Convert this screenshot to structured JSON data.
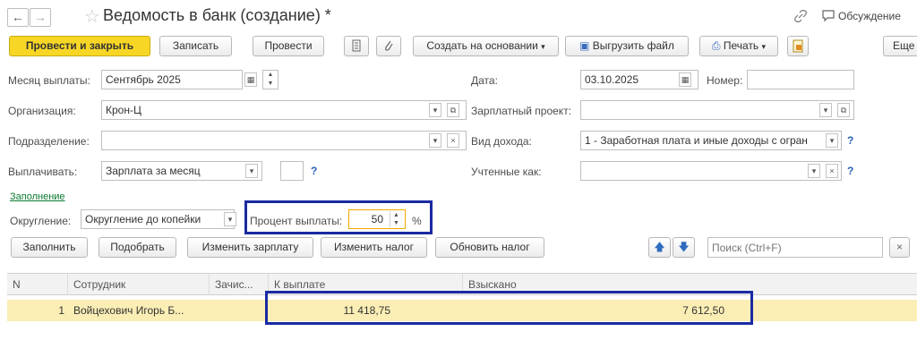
{
  "header": {
    "title": "Ведомость в банк (создание) *",
    "discussion": "Обсуждение"
  },
  "toolbar": {
    "post_close": "Провести и закрыть",
    "save": "Записать",
    "post": "Провести",
    "create_based": "Создать на основании",
    "export_file": "Выгрузить файл",
    "print": "Печать",
    "more": "Еще"
  },
  "form": {
    "month_label": "Месяц выплаты:",
    "month_value": "Сентябрь 2025",
    "date_label": "Дата:",
    "date_value": "03.10.2025",
    "number_label": "Номер:",
    "number_value": "",
    "org_label": "Организация:",
    "org_value": "Крон-Ц",
    "project_label": "Зарплатный проект:",
    "project_value": "",
    "division_label": "Подразделение:",
    "division_value": "",
    "income_label": "Вид дохода:",
    "income_value": "1 - Заработная плата и иные доходы с огран",
    "pay_label": "Выплачивать:",
    "pay_value": "Зарплата за месяц",
    "counted_label": "Учтенные как:",
    "counted_value": "",
    "fill_link": "Заполнение",
    "rounding_label": "Округление:",
    "rounding_value": "Округление до копейки",
    "percent_label": "Процент выплаты:",
    "percent_value": "50",
    "percent_sign": "%",
    "question": "?"
  },
  "table_toolbar": {
    "fill": "Заполнить",
    "pick": "Подобрать",
    "change_salary": "Изменить зарплату",
    "change_tax": "Изменить налог",
    "update_tax": "Обновить налог",
    "search_placeholder": "Поиск (Ctrl+F)",
    "clear": "×"
  },
  "table": {
    "columns": [
      "N",
      "Сотрудник",
      "Зачис...",
      "К выплате",
      "Взыскано"
    ],
    "rows": [
      {
        "n": "1",
        "employee": "Войцехович Игорь Б...",
        "credited": "",
        "to_pay": "11 418,75",
        "withheld": "7 612,50"
      }
    ]
  },
  "colors": {
    "primary_button": "#f8d626",
    "selected_row": "#fbeeb5",
    "highlight_frame": "#1a2aa0",
    "percent_field_border": "#f0a800"
  },
  "icons": [
    "back-arrow-icon",
    "forward-arrow-icon",
    "star-icon",
    "link-icon",
    "comment-icon",
    "document-icon",
    "paperclip-icon",
    "export-file-icon",
    "printer-icon",
    "report-icon",
    "calendar-icon",
    "arrow-up-icon",
    "arrow-down-icon"
  ]
}
